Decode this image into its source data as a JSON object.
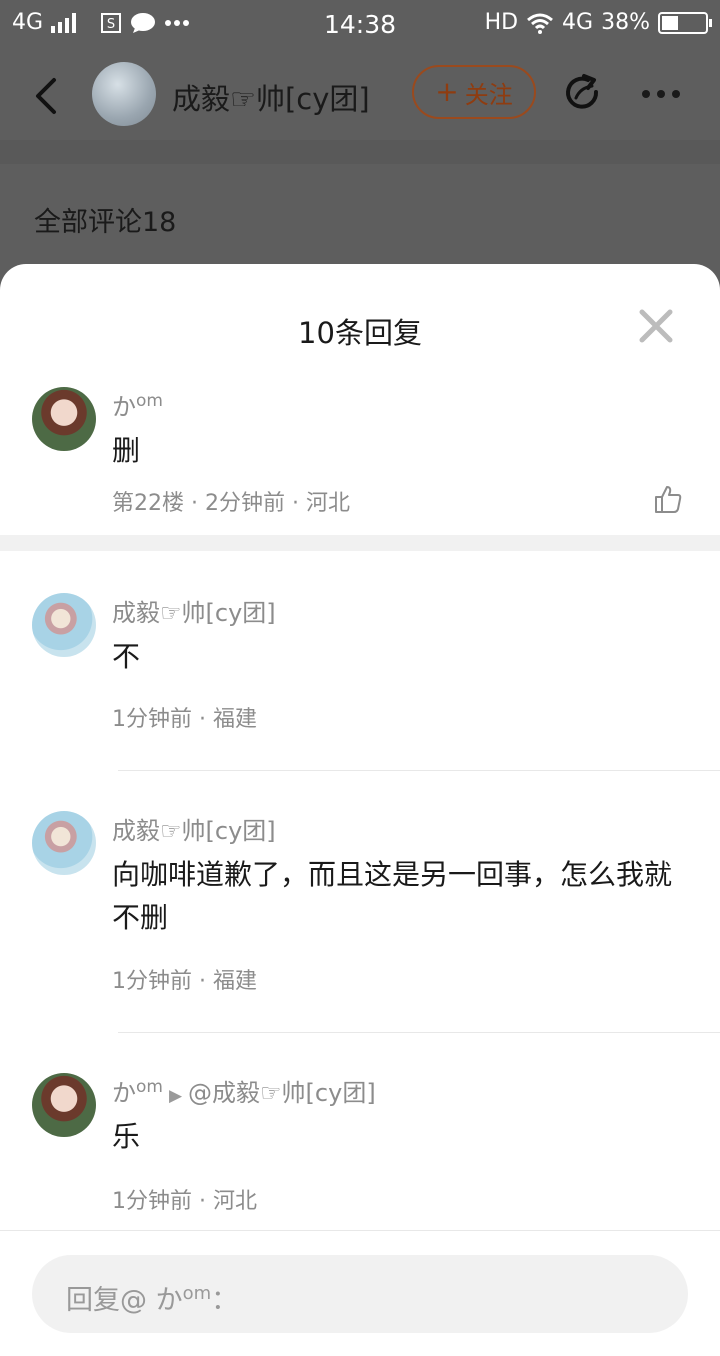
{
  "status_bar": {
    "network": "4G",
    "time": "14:38",
    "hd": "HD",
    "network_right": "4G",
    "battery_percent": 38,
    "battery_label": "38%"
  },
  "header": {
    "title": "成毅☞帅[cy团]",
    "follow_label": "关注"
  },
  "all_comments_label": "全部评论18",
  "sheet": {
    "title": "10条回复",
    "replies": [
      {
        "user_base": "か",
        "user_sup": "om",
        "reply_to": "",
        "text": "删",
        "meta": "第22楼 · 2分钟前 · 河北"
      },
      {
        "user_base": "成毅☞帅[cy团]",
        "user_sup": "",
        "reply_to": "",
        "text": "不",
        "meta": "1分钟前 · 福建"
      },
      {
        "user_base": "成毅☞帅[cy团]",
        "user_sup": "",
        "reply_to": "",
        "text": "向咖啡道歉了，而且这是另一回事，怎么我就不删",
        "meta": "1分钟前 · 福建"
      },
      {
        "user_base": "か",
        "user_sup": "om",
        "reply_to": "@成毅☞帅[cy团]",
        "text": "乐",
        "meta": "1分钟前 · 河北"
      }
    ]
  },
  "reply_input": {
    "prefix": "回复@ か",
    "sup": "om",
    "suffix": "："
  },
  "colors": {
    "follow_accent": "#8f3c10",
    "overlay": "#5e5e5e"
  }
}
